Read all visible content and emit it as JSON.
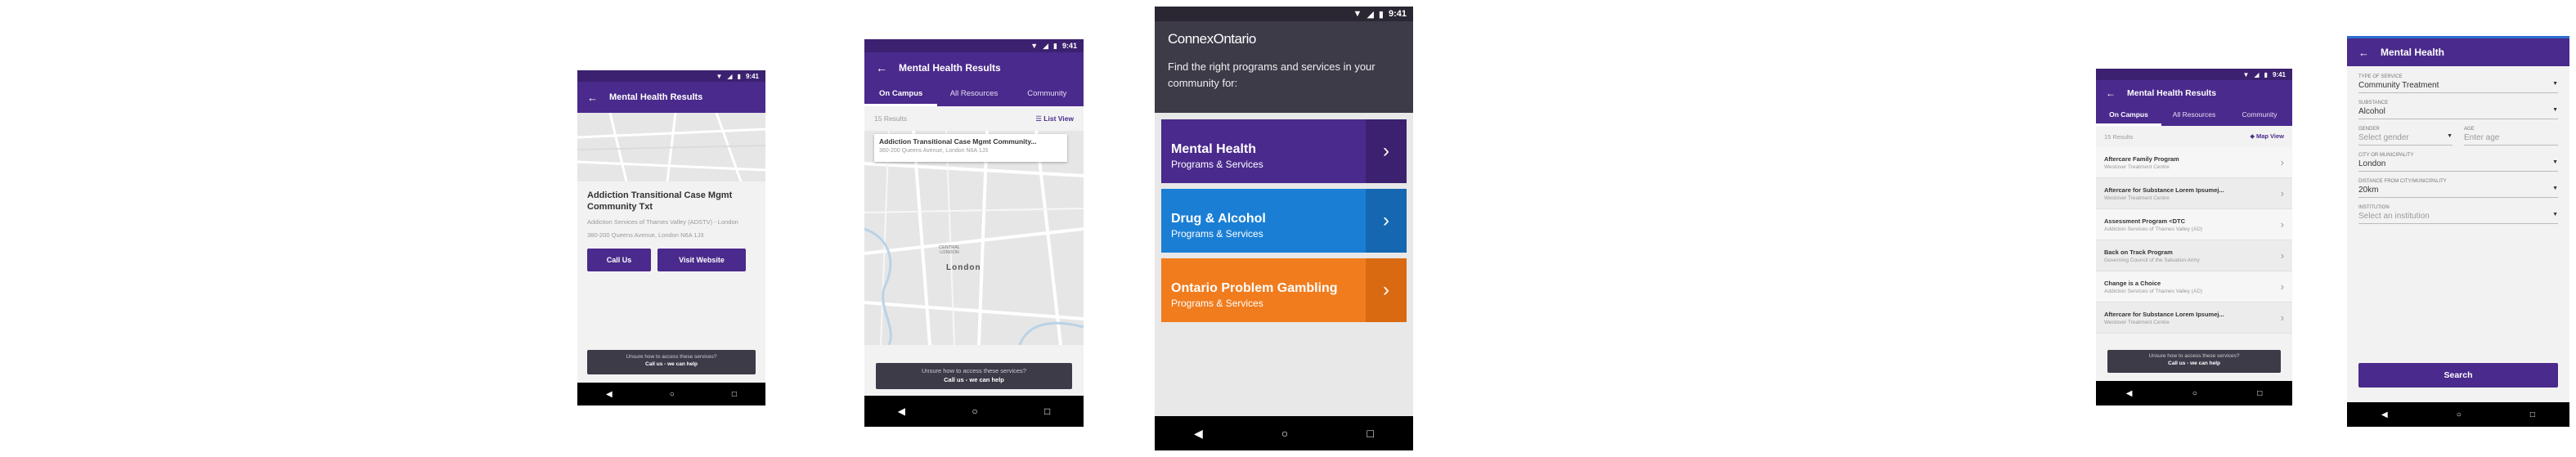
{
  "status": {
    "time": "9:41"
  },
  "screen1": {
    "title": "Mental Health Results",
    "program_name": "Addiction Transitional Case Mgmt Community Txt",
    "provider": "Addiction Services of Thames Valley (ADSTV) - London",
    "address": "380-200 Queens Avenue, London N6A 1J3",
    "call_label": "Call Us",
    "website_label": "Visit Website",
    "help_line1": "Unsure how to access these services?",
    "help_line2": "Call us - we can help"
  },
  "screen2": {
    "title": "Mental Health Results",
    "tabs": [
      "On Campus",
      "All Resources",
      "Community"
    ],
    "results_count": "15 Results",
    "view_toggle": "List View",
    "popup_title": "Addiction Transitional Case Mgmt Community...",
    "popup_address": "360-200 Queens Avenue, London N6A 1J3",
    "map_city": "London",
    "map_area": "CENTRAL LONDON",
    "help_line1": "Unsure how to access these services?",
    "help_line2": "Call us - we can help"
  },
  "screen3": {
    "brand": "ConnexOntario",
    "intro": "Find the right programs and services in your community for:",
    "categories": [
      {
        "title": "Mental Health",
        "subtitle": "Programs & Services",
        "color": "#4a2a8c",
        "chev_bg": "#3b2170"
      },
      {
        "title": "Drug & Alcohol",
        "subtitle": "Programs & Services",
        "color": "#1a7fd4",
        "chev_bg": "#1467b0"
      },
      {
        "title": "Ontario Problem Gambling",
        "subtitle": "Programs & Services",
        "color": "#f07c1e",
        "chev_bg": "#d96a12"
      }
    ]
  },
  "screen4": {
    "title": "Mental Health Results",
    "tabs": [
      "On Campus",
      "All Resources",
      "Community"
    ],
    "results_count": "15 Results",
    "view_toggle": "Map View",
    "items": [
      {
        "name": "Aftercare Family Program",
        "org": "Westover Treatment Centre"
      },
      {
        "name": "Aftercare for Substance Lorem Ipsumej...",
        "org": "Westover Treatment Centre"
      },
      {
        "name": "Assessment Program <DTC",
        "org": "Addiction Services of Thames Valley (AD)"
      },
      {
        "name": "Back on Track Program",
        "org": "Governing Council of the Salvation Army"
      },
      {
        "name": "Change is a Choice",
        "org": "Addiction Services of Thames Valley (AD)"
      },
      {
        "name": "Aftercare for Substance Lorem Ipsumej...",
        "org": "Westover Treatment Centre"
      }
    ],
    "help_line1": "Unsure how to access these services?",
    "help_line2": "Call us - we can help"
  },
  "screen5": {
    "title": "Mental Health",
    "type_label": "TYPE OF SERVICE",
    "type_value": "Community Treatment",
    "substance_label": "SUBSTANCE",
    "substance_value": "Alcohol",
    "gender_label": "GENDER",
    "gender_placeholder": "Select gender",
    "age_label": "AGE",
    "age_placeholder": "Enter age",
    "city_label": "CITY OR MUNICIPALITY",
    "city_value": "London",
    "distance_label": "DISTANCE FROM CITY/MUNICIPALITY",
    "distance_value": "20km",
    "institution_label": "INSTITUTION",
    "institution_placeholder": "Select an institution",
    "search_label": "Search"
  }
}
